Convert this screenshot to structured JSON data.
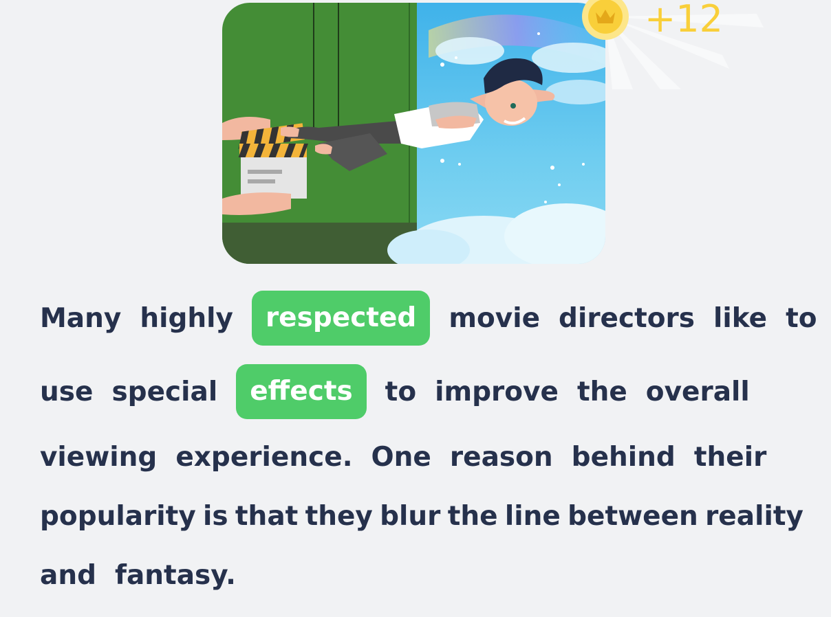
{
  "illustration": {
    "scene": "director-clapperboard-flying-boy",
    "colors": {
      "green_screen": "#448d36",
      "floor": "#405e34",
      "sky": "#5cc1ea",
      "cloud": "#dff4fc"
    }
  },
  "reward": {
    "icon": "crown-coin-icon",
    "points": "+12",
    "color": "#f9cf3a"
  },
  "passage": {
    "lines": [
      {
        "words": [
          {
            "text": "Many",
            "highlight": false
          },
          {
            "text": "highly",
            "highlight": false
          },
          {
            "text": "respected",
            "highlight": true
          },
          {
            "text": "movie",
            "highlight": false
          },
          {
            "text": "directors",
            "highlight": false
          },
          {
            "text": "like",
            "highlight": false
          },
          {
            "text": "to",
            "highlight": false
          }
        ]
      },
      {
        "words": [
          {
            "text": "use",
            "highlight": false
          },
          {
            "text": "special",
            "highlight": false
          },
          {
            "text": "effects",
            "highlight": true
          },
          {
            "text": "to",
            "highlight": false
          },
          {
            "text": "improve",
            "highlight": false
          },
          {
            "text": "the",
            "highlight": false
          },
          {
            "text": "overall",
            "highlight": false
          }
        ]
      },
      {
        "words": [
          {
            "text": "viewing",
            "highlight": false
          },
          {
            "text": "experience.",
            "highlight": false
          },
          {
            "text": "One",
            "highlight": false
          },
          {
            "text": "reason",
            "highlight": false
          },
          {
            "text": "behind",
            "highlight": false
          },
          {
            "text": "their",
            "highlight": false
          }
        ]
      },
      {
        "words": [
          {
            "text": "popularity",
            "highlight": false
          },
          {
            "text": "is",
            "highlight": false
          },
          {
            "text": "that",
            "highlight": false
          },
          {
            "text": "they",
            "highlight": false
          },
          {
            "text": "blur",
            "highlight": false
          },
          {
            "text": "the",
            "highlight": false
          },
          {
            "text": "line",
            "highlight": false
          },
          {
            "text": "between",
            "highlight": false
          },
          {
            "text": "reality",
            "highlight": false
          }
        ]
      },
      {
        "words": [
          {
            "text": "and",
            "highlight": false
          },
          {
            "text": "fantasy.",
            "highlight": false
          }
        ]
      }
    ],
    "text_color": "#26314c",
    "highlight_color": "#4fcc69"
  }
}
